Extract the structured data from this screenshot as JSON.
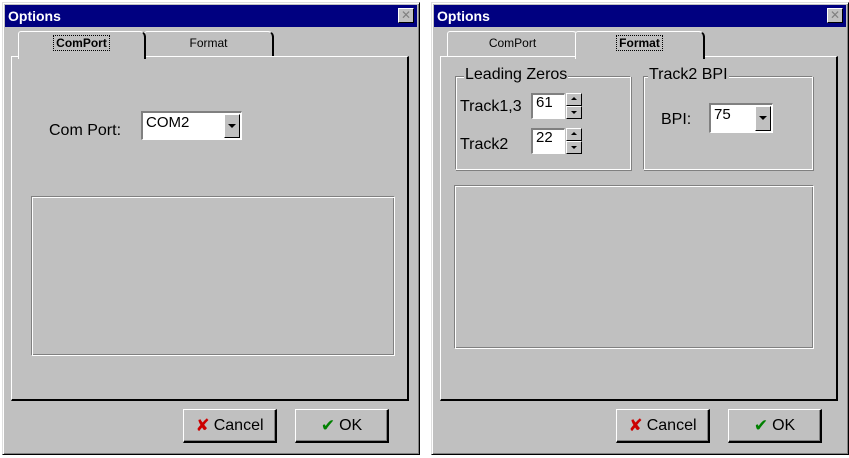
{
  "left_window": {
    "title": "Options",
    "tabs": [
      {
        "label": "ComPort",
        "active": true
      },
      {
        "label": "Format",
        "active": false
      }
    ],
    "com_port_label": "Com Port:",
    "com_port_value": "COM2",
    "cancel_label": "Cancel",
    "ok_label": "OK"
  },
  "right_window": {
    "title": "Options",
    "tabs": [
      {
        "label": "ComPort",
        "active": false
      },
      {
        "label": "Format",
        "active": true
      }
    ],
    "leading_zeros": {
      "title": "Leading Zeros",
      "track13_label": "Track1,3",
      "track13_value": "61",
      "track2_label": "Track2",
      "track2_value": "22"
    },
    "track2_bpi": {
      "title": "Track2 BPI",
      "bpi_label": "BPI:",
      "bpi_value": "75"
    },
    "cancel_label": "Cancel",
    "ok_label": "OK"
  },
  "icons": {
    "close": "close-icon",
    "cancel": "x-icon",
    "ok": "check-icon"
  },
  "colors": {
    "titlebar": "#000080",
    "face": "#c0c0c0",
    "cancel_icon": "#cc0000",
    "ok_icon": "#008000"
  }
}
